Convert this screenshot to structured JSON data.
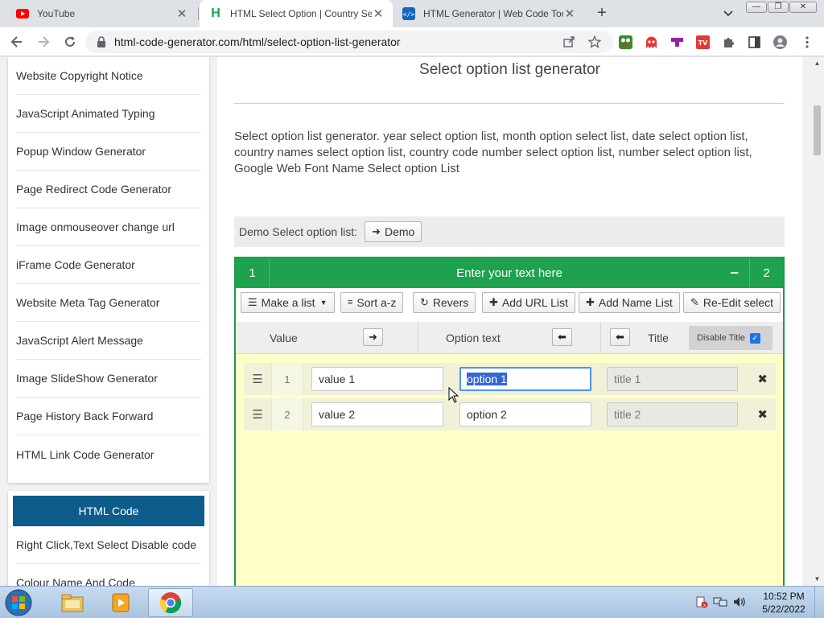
{
  "browser": {
    "tabs": [
      {
        "title": "YouTube",
        "icon": "youtube-icon"
      },
      {
        "title": "HTML Select Option | Country Se",
        "icon": "h-logo-icon"
      },
      {
        "title": "HTML Generator | Web Code Too",
        "icon": "code-icon"
      }
    ],
    "new_tab": "+",
    "url": "html-code-generator.com/html/select-option-list-generator"
  },
  "sidebar": {
    "items": [
      "Website Copyright Notice",
      "JavaScript Animated Typing",
      "Popup Window Generator",
      "Page Redirect Code Generator",
      "Image onmouseover change url",
      "iFrame Code Generator",
      "Website Meta Tag Generator",
      "JavaScript Alert Message",
      "Image SlideShow Generator",
      "Page History Back Forward",
      "HTML Link Code Generator"
    ],
    "section_header": "HTML Code",
    "section_items": [
      "Right Click,Text Select Disable code",
      "Colour Name And Code"
    ]
  },
  "main": {
    "title": "Select option list generator",
    "description": "Select option list generator. year select option list, month option select list, date select option list, country names select option list, country code number select option list, number select option list, Google Web Font Name Select option List",
    "demo_label": "Demo Select option list:",
    "demo_button": "Demo"
  },
  "generator": {
    "header_left": "1",
    "header_text": "Enter your text here",
    "header_minus": "−",
    "header_right": "2",
    "toolbar": {
      "make_list": "Make a list",
      "sort": "Sort a-z",
      "revers": "Revers",
      "add_url": "Add URL List",
      "add_name": "Add Name List",
      "re_edit": "Re-Edit select"
    },
    "columns": {
      "value": "Value",
      "option_text": "Option text",
      "title": "Title",
      "disable_title": "Disable Title"
    },
    "rows": [
      {
        "num": "1",
        "value": "value 1",
        "option": "option 1",
        "title": "title 1"
      },
      {
        "num": "2",
        "value": "value 2",
        "option": "option 2",
        "title": "title 2"
      }
    ]
  },
  "taskbar": {
    "time": "10:52 PM",
    "date": "5/22/2022"
  },
  "colors": {
    "green_header": "#1ea24e",
    "panel_bg": "#ffffc8",
    "sidebar_header": "#0d5c8a"
  }
}
